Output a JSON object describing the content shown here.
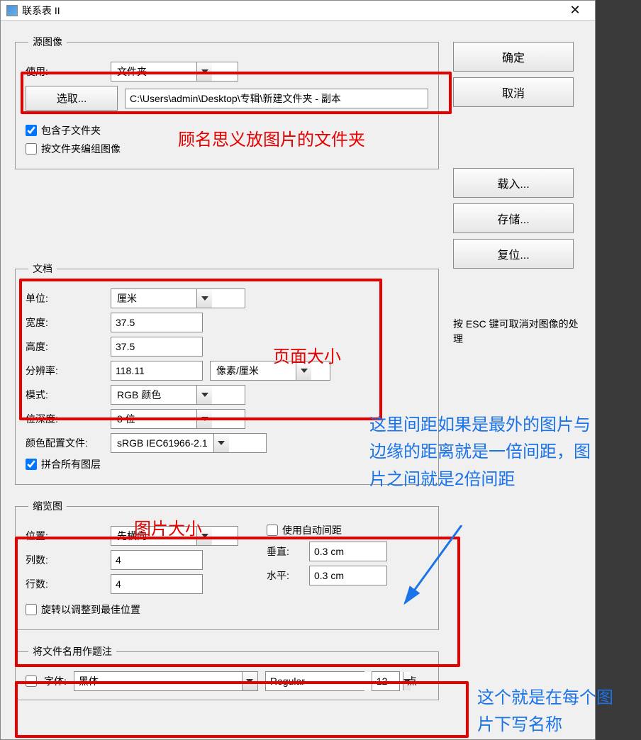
{
  "titlebar": {
    "title": "联系表 II"
  },
  "buttons": {
    "ok": "确定",
    "cancel": "取消",
    "load": "载入...",
    "save": "存储...",
    "reset": "复位...",
    "choose": "选取..."
  },
  "source": {
    "legend": "源图像",
    "use_label": "使用:",
    "use_value": "文件夹",
    "path": "C:\\Users\\admin\\Desktop\\专辑\\新建文件夹 - 副本",
    "include_sub": "包含子文件夹",
    "group_by_folder": "按文件夹编组图像"
  },
  "document": {
    "legend": "文档",
    "unit_label": "单位:",
    "unit_value": "厘米",
    "width_label": "宽度:",
    "width_value": "37.5",
    "height_label": "高度:",
    "height_value": "37.5",
    "res_label": "分辨率:",
    "res_value": "118.11",
    "res_unit": "像素/厘米",
    "mode_label": "模式:",
    "mode_value": "RGB 颜色",
    "bit_label": "位深度:",
    "bit_value": "8 位",
    "profile_label": "颜色配置文件:",
    "profile_value": "sRGB IEC61966-2.1",
    "flatten": "拼合所有图层"
  },
  "thumb": {
    "legend": "缩览图",
    "place_label": "位置:",
    "place_value": "先横向",
    "cols_label": "列数:",
    "cols_value": "4",
    "rows_label": "行数:",
    "rows_value": "4",
    "auto_spacing": "使用自动间距",
    "vert_label": "垂直:",
    "vert_value": "0.3 cm",
    "horz_label": "水平:",
    "horz_value": "0.3 cm",
    "rotate": "旋转以调整到最佳位置"
  },
  "caption": {
    "legend": "将文件名用作题注",
    "font_label": "字体:",
    "font_name": "黑体",
    "font_style": "Regular",
    "font_size": "12",
    "font_unit": "点"
  },
  "hint": {
    "esc": "按 ESC 键可取消对图像的处理"
  },
  "anno": {
    "a1": "顾名思义放图片的文件夹",
    "a2": "页面大小",
    "a3": "图片大小",
    "a4": "这里间距如果是最外的图片与边缘的距离就是一倍间距，图片之间就是2倍间距",
    "a5": "这个就是在每个图片下写名称"
  }
}
